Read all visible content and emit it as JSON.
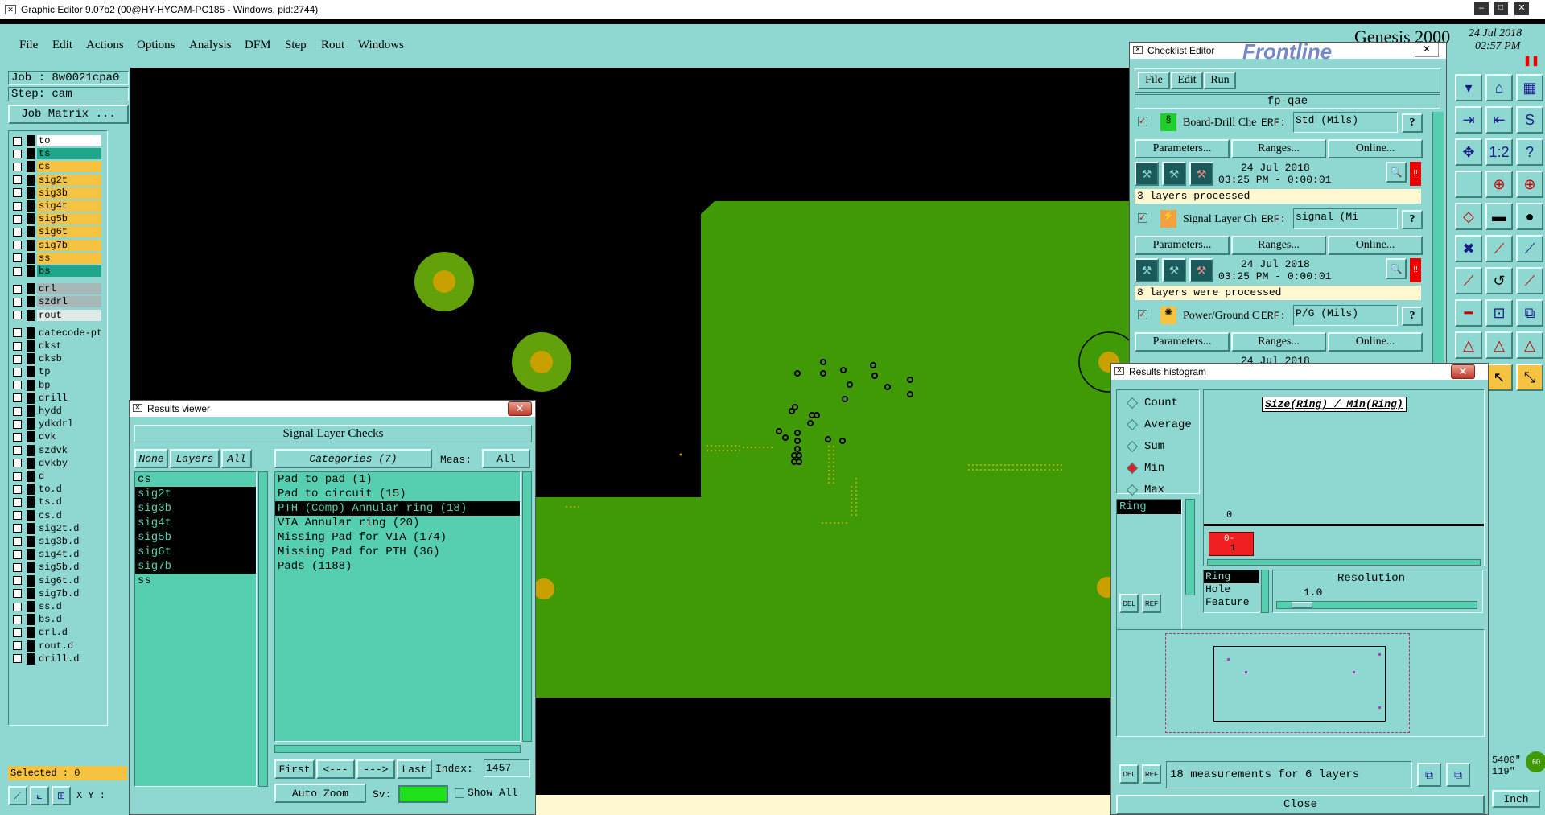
{
  "app": {
    "title": "Graphic Editor 9.07b2 (00@HY-HYCAM-PC185 - Windows, pid:2744)",
    "brand": "Genesis 2000",
    "date": "24 Jul 2018",
    "time": "02:57 PM",
    "logo": "Frontline"
  },
  "menu": [
    "File",
    "Edit",
    "Actions",
    "Options",
    "Analysis",
    "DFM",
    "Step",
    "Rout",
    "Windows"
  ],
  "job": {
    "job_label": "Job : 8w0021cpa0",
    "step_label": "Step: cam",
    "matrix_button": "Job Matrix ..."
  },
  "layers": [
    {
      "name": "to",
      "color": "#ffffff"
    },
    {
      "name": "ts",
      "color": "#1fa58a"
    },
    {
      "name": "cs",
      "color": "#f5c242"
    },
    {
      "name": "sig2t",
      "color": "#f5c242"
    },
    {
      "name": "sig3b",
      "color": "#f5c242"
    },
    {
      "name": "sig4t",
      "color": "#f5c242"
    },
    {
      "name": "sig5b",
      "color": "#f5c242"
    },
    {
      "name": "sig6t",
      "color": "#f5c242"
    },
    {
      "name": "sig7b",
      "color": "#f5c242"
    },
    {
      "name": "ss",
      "color": "#f5c242"
    },
    {
      "name": "bs",
      "color": "#1fa58a"
    },
    {
      "name": "drl",
      "color": "#a8b8b8"
    },
    {
      "name": "szdrl",
      "color": "#a8b8b8"
    },
    {
      "name": "rout",
      "color": "#e0e8e8"
    },
    {
      "name": "datecode-pt",
      "color": "#8fd8d2"
    },
    {
      "name": "dkst",
      "color": "#8fd8d2"
    },
    {
      "name": "dksb",
      "color": "#8fd8d2"
    },
    {
      "name": "tp",
      "color": "#8fd8d2"
    },
    {
      "name": "bp",
      "color": "#8fd8d2"
    },
    {
      "name": "drill",
      "color": "#8fd8d2"
    },
    {
      "name": "hydd",
      "color": "#8fd8d2"
    },
    {
      "name": "ydkdrl",
      "color": "#8fd8d2"
    },
    {
      "name": "dvk",
      "color": "#8fd8d2"
    },
    {
      "name": "szdvk",
      "color": "#8fd8d2"
    },
    {
      "name": "dvkby",
      "color": "#8fd8d2"
    },
    {
      "name": "d",
      "color": "#8fd8d2"
    },
    {
      "name": "to.d",
      "color": "#8fd8d2"
    },
    {
      "name": "ts.d",
      "color": "#8fd8d2"
    },
    {
      "name": "cs.d",
      "color": "#8fd8d2"
    },
    {
      "name": "sig2t.d",
      "color": "#8fd8d2"
    },
    {
      "name": "sig3b.d",
      "color": "#8fd8d2"
    },
    {
      "name": "sig4t.d",
      "color": "#8fd8d2"
    },
    {
      "name": "sig5b.d",
      "color": "#8fd8d2"
    },
    {
      "name": "sig6t.d",
      "color": "#8fd8d2"
    },
    {
      "name": "sig7b.d",
      "color": "#8fd8d2"
    },
    {
      "name": "ss.d",
      "color": "#8fd8d2"
    },
    {
      "name": "bs.d",
      "color": "#8fd8d2"
    },
    {
      "name": "drl.d",
      "color": "#8fd8d2"
    },
    {
      "name": "rout.d",
      "color": "#8fd8d2"
    },
    {
      "name": "drill.d",
      "color": "#8fd8d2"
    }
  ],
  "status": {
    "selected": "Selected : 0",
    "xy": "X Y :",
    "coord1": "5400\"",
    "coord2": "119\"",
    "unit": "Inch"
  },
  "results_viewer": {
    "title": "Results viewer",
    "header": "Signal Layer Checks",
    "none": "None",
    "layers": "Layers",
    "all": "All",
    "categories_label": "Categories (7)",
    "meas_label": "Meas:",
    "meas_value": "All",
    "layer_list": [
      "cs",
      "sig2t",
      "sig3b",
      "sig4t",
      "sig5b",
      "sig6t",
      "sig7b",
      "ss"
    ],
    "category_list": [
      "Pad to pad (1)",
      "Pad to circuit (15)",
      "PTH (Comp) Annular ring (18)",
      "VIA Annular ring (20)",
      "Missing Pad for VIA (174)",
      "Missing Pad for PTH (36)",
      "Pads (1188)"
    ],
    "first": "First",
    "prev": "<---",
    "next": "--->",
    "last": "Last",
    "index_label": "Index:",
    "index_value": "1457",
    "zoom": "Auto Zoom",
    "sv": "Sv:",
    "show_all": "Show All"
  },
  "checklist": {
    "title": "Checklist Editor",
    "menu": [
      "File",
      "Edit",
      "Run"
    ],
    "name": "fp-qae",
    "erf": "ERF:",
    "params": "Parameters...",
    "ranges": "Ranges...",
    "online": "Online...",
    "items": [
      {
        "name": "Board-Drill Che",
        "erf": "Std (Mils)",
        "date": "24 Jul 2018",
        "time": "03:25 PM - 0:00:01",
        "status": "3 layers processed"
      },
      {
        "name": "Signal Layer Ch",
        "erf": "signal (Mi",
        "date": "24 Jul 2018",
        "time": "03:25 PM - 0:00:01",
        "status": "8 layers were processed"
      },
      {
        "name": "Power/Ground C",
        "erf": "P/G (Mils)",
        "date": "24 Jul 2018"
      }
    ]
  },
  "histogram": {
    "title": "Results histogram",
    "modes": [
      "Count",
      "Average",
      "Sum",
      "Min",
      "Max"
    ],
    "selected_mode": "Min",
    "graph_title": "Size(Ring) / Min(Ring)",
    "axis_zero": "0",
    "bar_label_top": "0-",
    "bar_label_bottom": "1",
    "list": [
      "Ring"
    ],
    "types": [
      "Ring",
      "Hole",
      "Feature"
    ],
    "resolution_label": "Resolution",
    "resolution_value": "1.0",
    "del": "DEL",
    "ref": "REF",
    "summary": "18 measurements for 6 layers",
    "close": "Close"
  },
  "colors": {
    "board": "#3f9a06",
    "pad_ring": "#62a10a",
    "pad_core": "#c8a000",
    "panel": "#8fd8d2",
    "list_bg": "#56cfb0"
  }
}
